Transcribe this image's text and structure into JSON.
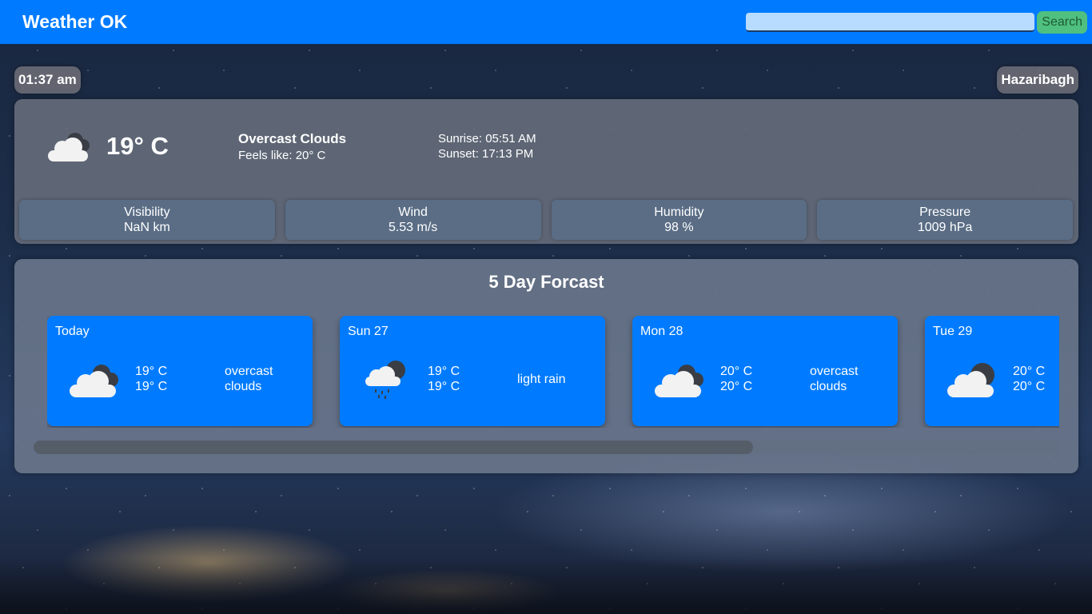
{
  "header": {
    "brand": "Weather OK",
    "search_placeholder": "",
    "search_button": "Search"
  },
  "time": "01:37 am",
  "location": "Hazaribagh",
  "current": {
    "icon": "overcast-clouds-icon",
    "temp": "19° C",
    "description": "Overcast Clouds",
    "feels_like": "Feels like: 20° C",
    "sunrise": "Sunrise: 05:51 AM",
    "sunset": "Sunset: 17:13 PM",
    "stats": [
      {
        "label": "Visibility",
        "value": "NaN km"
      },
      {
        "label": "Wind",
        "value": "5.53 m/s"
      },
      {
        "label": "Humidity",
        "value": "98 %"
      },
      {
        "label": "Pressure",
        "value": "1009 hPa"
      }
    ]
  },
  "forecast": {
    "title": "5 Day Forcast",
    "days": [
      {
        "day": "Today",
        "temp_max": "19° C",
        "temp_min": "19° C",
        "desc": "overcast clouds",
        "icon": "overcast-clouds-icon"
      },
      {
        "day": "Sun 27",
        "temp_max": "19° C",
        "temp_min": "19° C",
        "desc": "light rain",
        "icon": "light-rain-icon"
      },
      {
        "day": "Mon 28",
        "temp_max": "20° C",
        "temp_min": "20° C",
        "desc": "overcast clouds",
        "icon": "overcast-clouds-icon"
      },
      {
        "day": "Tue 29",
        "temp_max": "20° C",
        "temp_min": "20° C",
        "desc": "",
        "icon": "broken-clouds-icon"
      }
    ],
    "scroll_position": 0.0
  },
  "colors": {
    "accent": "#007bff",
    "search_button": "#4fc07f"
  }
}
